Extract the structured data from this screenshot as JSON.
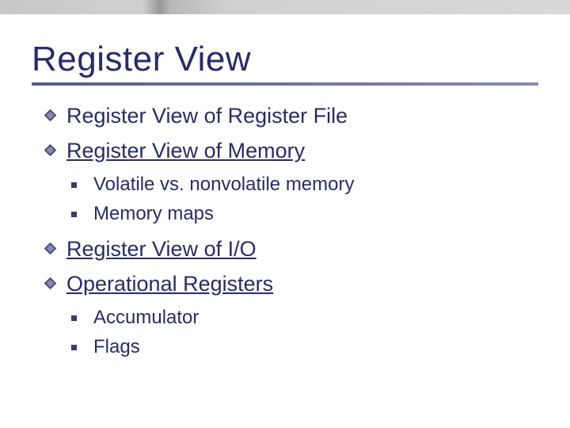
{
  "title": "Register View",
  "items": [
    {
      "level": 1,
      "text": "Register View of Register File",
      "link": false
    },
    {
      "level": 1,
      "text": "Register View of Memory",
      "link": true
    },
    {
      "level": 2,
      "text": "Volatile vs. nonvolatile memory"
    },
    {
      "level": 2,
      "text": "Memory maps"
    },
    {
      "level": 1,
      "text": "Register View of I/O",
      "link": true
    },
    {
      "level": 1,
      "text": "Operational Registers",
      "link": true
    },
    {
      "level": 2,
      "text": "Accumulator"
    },
    {
      "level": 2,
      "text": "Flags"
    }
  ]
}
